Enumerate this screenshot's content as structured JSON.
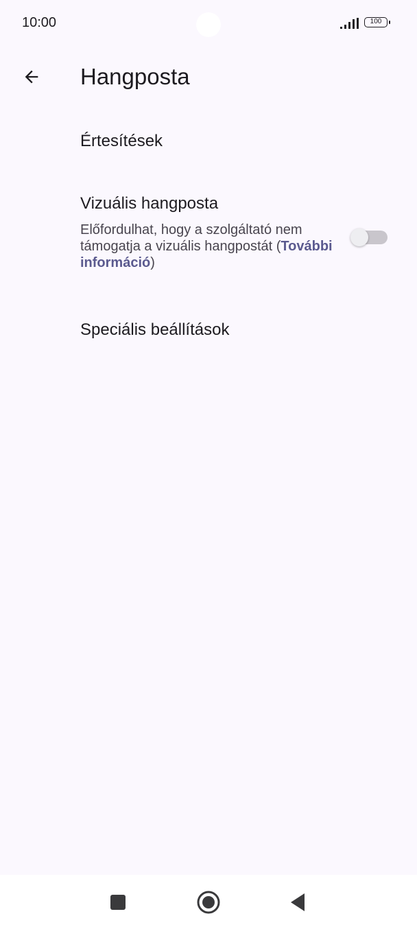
{
  "status_bar": {
    "time": "10:00",
    "battery": "100"
  },
  "header": {
    "title": "Hangposta"
  },
  "settings": {
    "notifications": {
      "title": "Értesítések"
    },
    "visual_voicemail": {
      "title": "Vizuális hangposta",
      "subtitle_prefix": "Előfordulhat, hogy a szolgáltató nem támogatja a vizuális hangpostát (",
      "link": "További információ",
      "subtitle_suffix": ")",
      "enabled": false
    },
    "advanced": {
      "title": "Speciális beállítások"
    }
  },
  "colors": {
    "background": "#fbf8fe",
    "link": "#5b5a8f",
    "toggle_track": "#c9c6cc"
  },
  "icons": {
    "back": "arrow-left-icon",
    "recents": "square-icon",
    "home": "circle-icon",
    "back_nav": "triangle-left-icon"
  }
}
